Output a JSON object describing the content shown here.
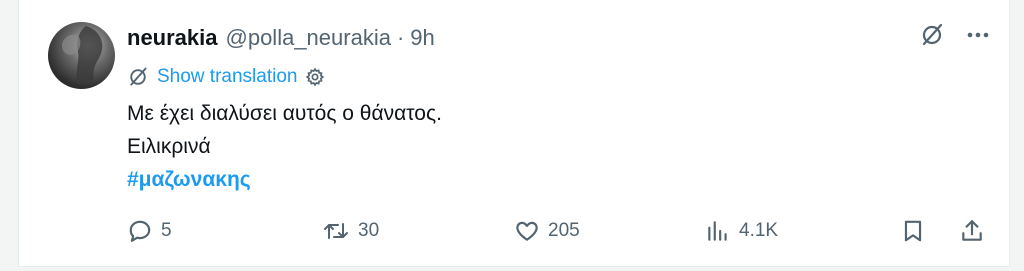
{
  "tweet": {
    "display_name": "neurakia",
    "handle": "@polla_neurakia",
    "separator": "·",
    "time": "9h",
    "show_translation": "Show translation",
    "text_line1": "Με έχει διαλύσει αυτός ο θάνατος.",
    "text_line2": "Ειλικρινά",
    "hashtag": "#μαζωνακης"
  },
  "actions": {
    "replies": "5",
    "retweets": "30",
    "likes": "205",
    "views": "4.1K"
  },
  "colors": {
    "link": "#1d9bf0",
    "muted": "#536471",
    "text": "#0f1419"
  },
  "icons": [
    "avatar",
    "grok-icon",
    "more-icon",
    "translate-icon",
    "gear-icon",
    "reply-icon",
    "retweet-icon",
    "like-icon",
    "views-icon",
    "bookmark-icon",
    "share-icon"
  ]
}
